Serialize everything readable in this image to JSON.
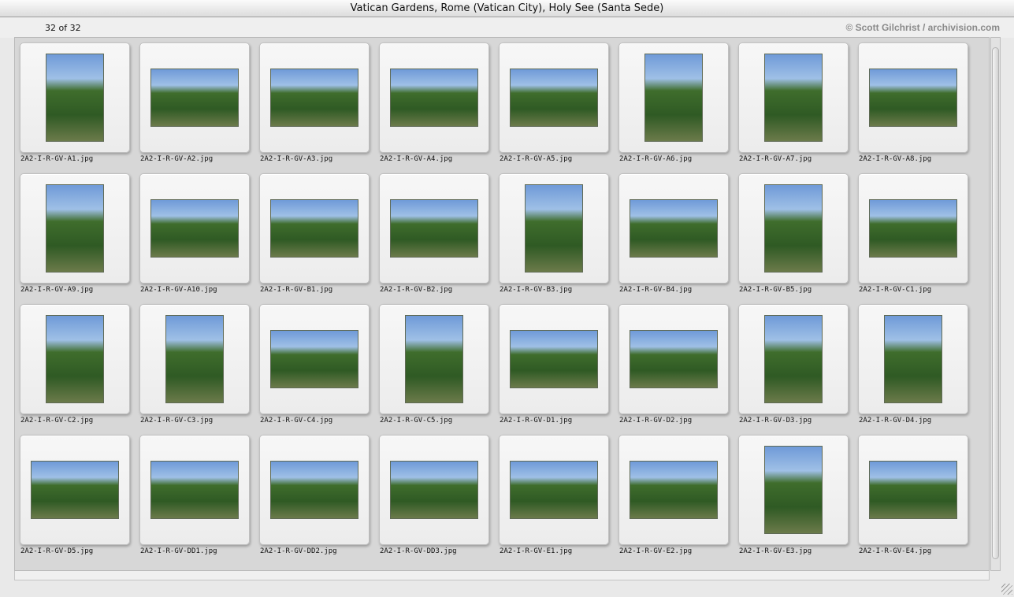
{
  "window": {
    "title": "Vatican Gardens, Rome (Vatican City), Holy See (Santa Sede)"
  },
  "header": {
    "count": "32 of 32",
    "credit": "© Scott Gilchrist / archivision.com"
  },
  "thumbnails": [
    {
      "file": "2A2-I-R-GV-A1.jpg",
      "orientation": "portrait"
    },
    {
      "file": "2A2-I-R-GV-A2.jpg",
      "orientation": "landscape"
    },
    {
      "file": "2A2-I-R-GV-A3.jpg",
      "orientation": "landscape"
    },
    {
      "file": "2A2-I-R-GV-A4.jpg",
      "orientation": "landscape"
    },
    {
      "file": "2A2-I-R-GV-A5.jpg",
      "orientation": "landscape"
    },
    {
      "file": "2A2-I-R-GV-A6.jpg",
      "orientation": "portrait"
    },
    {
      "file": "2A2-I-R-GV-A7.jpg",
      "orientation": "portrait"
    },
    {
      "file": "2A2-I-R-GV-A8.jpg",
      "orientation": "landscape"
    },
    {
      "file": "2A2-I-R-GV-A9.jpg",
      "orientation": "portrait"
    },
    {
      "file": "2A2-I-R-GV-A10.jpg",
      "orientation": "landscape"
    },
    {
      "file": "2A2-I-R-GV-B1.jpg",
      "orientation": "landscape"
    },
    {
      "file": "2A2-I-R-GV-B2.jpg",
      "orientation": "landscape"
    },
    {
      "file": "2A2-I-R-GV-B3.jpg",
      "orientation": "portrait"
    },
    {
      "file": "2A2-I-R-GV-B4.jpg",
      "orientation": "landscape"
    },
    {
      "file": "2A2-I-R-GV-B5.jpg",
      "orientation": "portrait"
    },
    {
      "file": "2A2-I-R-GV-C1.jpg",
      "orientation": "landscape"
    },
    {
      "file": "2A2-I-R-GV-C2.jpg",
      "orientation": "portrait"
    },
    {
      "file": "2A2-I-R-GV-C3.jpg",
      "orientation": "portrait"
    },
    {
      "file": "2A2-I-R-GV-C4.jpg",
      "orientation": "landscape"
    },
    {
      "file": "2A2-I-R-GV-C5.jpg",
      "orientation": "portrait"
    },
    {
      "file": "2A2-I-R-GV-D1.jpg",
      "orientation": "landscape"
    },
    {
      "file": "2A2-I-R-GV-D2.jpg",
      "orientation": "landscape"
    },
    {
      "file": "2A2-I-R-GV-D3.jpg",
      "orientation": "portrait"
    },
    {
      "file": "2A2-I-R-GV-D4.jpg",
      "orientation": "portrait"
    },
    {
      "file": "2A2-I-R-GV-D5.jpg",
      "orientation": "landscape"
    },
    {
      "file": "2A2-I-R-GV-DD1.jpg",
      "orientation": "landscape"
    },
    {
      "file": "2A2-I-R-GV-DD2.jpg",
      "orientation": "landscape"
    },
    {
      "file": "2A2-I-R-GV-DD3.jpg",
      "orientation": "landscape"
    },
    {
      "file": "2A2-I-R-GV-E1.jpg",
      "orientation": "landscape"
    },
    {
      "file": "2A2-I-R-GV-E2.jpg",
      "orientation": "landscape"
    },
    {
      "file": "2A2-I-R-GV-E3.jpg",
      "orientation": "portrait"
    },
    {
      "file": "2A2-I-R-GV-E4.jpg",
      "orientation": "landscape"
    }
  ]
}
